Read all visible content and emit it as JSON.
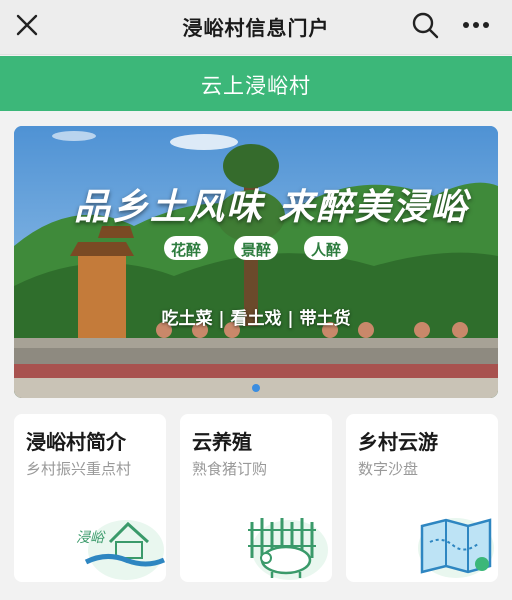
{
  "header": {
    "title": "浸峪村信息门户",
    "close_icon": "close-icon",
    "search_icon": "search-icon",
    "more_icon": "more-icon"
  },
  "section_bar": {
    "title": "云上浸峪村"
  },
  "banner": {
    "headline": "品乡土风味 来醉美浸峪",
    "pills": [
      "花醉",
      "景醉",
      "人醉"
    ],
    "slogan": "吃土菜 | 看土戏 | 带土货",
    "carousel_count": 1,
    "colors": {
      "sky": "#5fa0d8",
      "foliage": "#3f8a3a",
      "accent": "#3b8de0"
    }
  },
  "cards": [
    {
      "title": "浸峪村简介",
      "subtitle": "乡村振兴重点村",
      "icon": "village-logo-icon"
    },
    {
      "title": "云养殖",
      "subtitle": "熟食猪订购",
      "icon": "pig-icon"
    },
    {
      "title": "乡村云游",
      "subtitle": "数字沙盘",
      "icon": "map-icon"
    }
  ],
  "colors": {
    "green": "#3cb779",
    "background": "#f2f2f2"
  }
}
